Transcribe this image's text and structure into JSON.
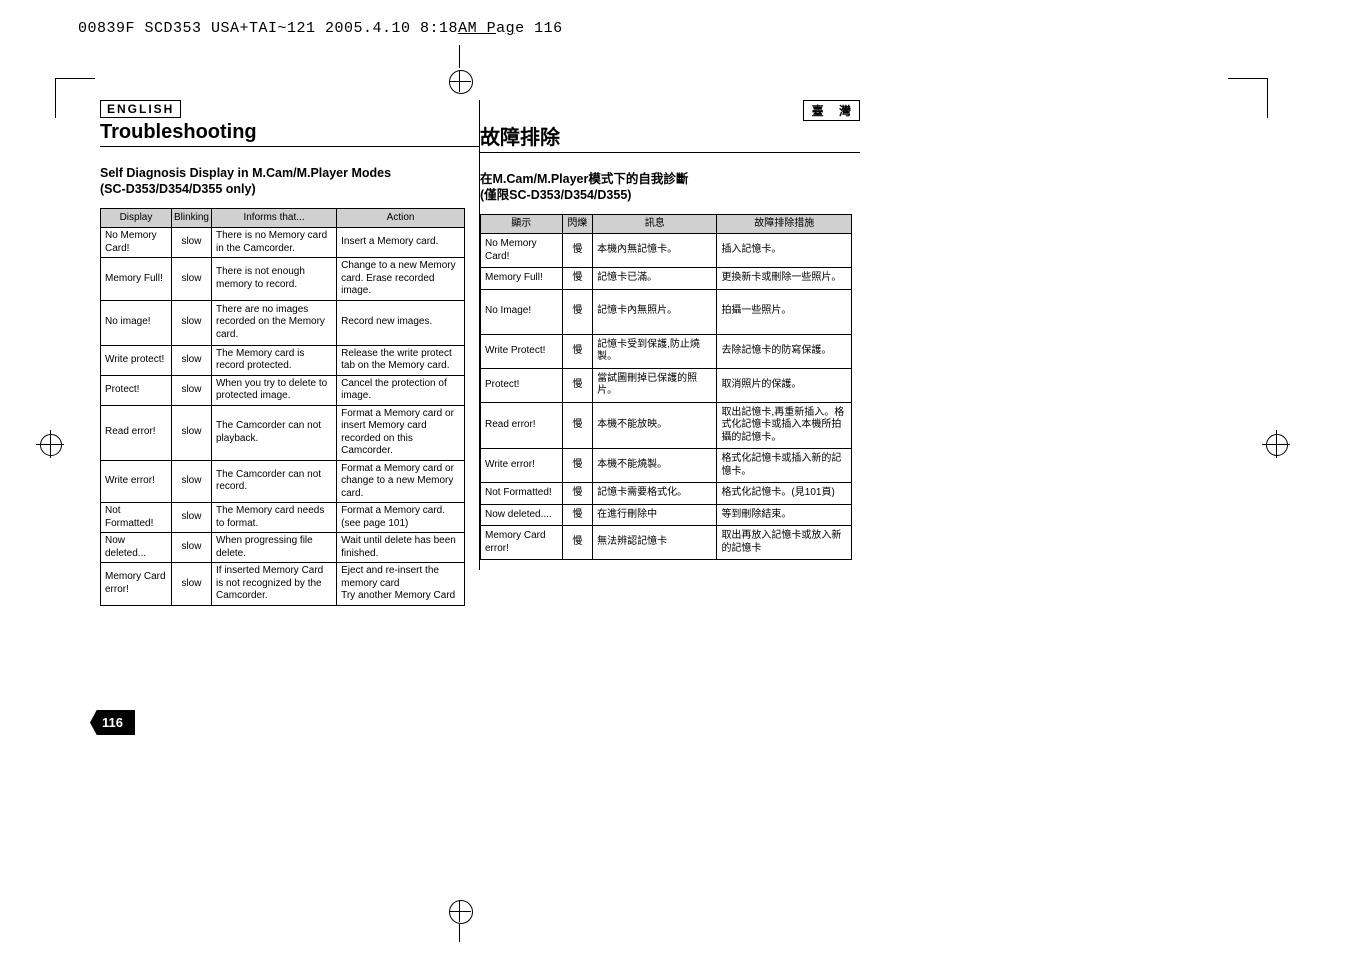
{
  "filename_line": {
    "prefix": "00839F SCD353 USA+TAI~121  2005.4.10  8:18",
    "u1": "AM  P",
    "mid": "a",
    "u2": "g",
    "suffix": "e 116"
  },
  "left": {
    "lang": "ENGLISH",
    "title": "Troubleshooting",
    "sub_line1": "Self Diagnosis Display in M.Cam/M.Player Modes",
    "sub_line2": "(SC-D353/D354/D355 only)",
    "headers": {
      "c1": "Display",
      "c2": "Blinking",
      "c3": "Informs that...",
      "c4": "Action"
    },
    "rows": [
      {
        "c1": "No Memory Card!",
        "c2": "slow",
        "c3": "There is no Memory card in the Camcorder.",
        "c4": "Insert a Memory card."
      },
      {
        "c1": "Memory Full!",
        "c2": "slow",
        "c3": "There is not enough memory to record.",
        "c4": "Change to a new Memory card. Erase recorded image."
      },
      {
        "c1": "No image!",
        "c2": "slow",
        "c3": "There are no images recorded on the Memory card.",
        "c4": "Record new images."
      },
      {
        "c1": "Write protect!",
        "c2": "slow",
        "c3": "The Memory card is record protected.",
        "c4": "Release the write protect tab on the Memory card."
      },
      {
        "c1": "Protect!",
        "c2": "slow",
        "c3": "When you try to delete to protected image.",
        "c4": "Cancel the protection of image."
      },
      {
        "c1": "Read error!",
        "c2": "slow",
        "c3": "The Camcorder can not playback.",
        "c4": "Format a Memory card or insert Memory card recorded on this Camcorder."
      },
      {
        "c1": "Write error!",
        "c2": "slow",
        "c3": "The Camcorder can not record.",
        "c4": "Format a Memory card or change to a new Memory card."
      },
      {
        "c1": "Not Formatted!",
        "c2": "slow",
        "c3": "The Memory card needs to format.",
        "c4": "Format a Memory card. (see page 101)"
      },
      {
        "c1": "Now deleted...",
        "c2": "slow",
        "c3": "When progressing file delete.",
        "c4": "Wait until delete has been finished."
      },
      {
        "c1": "Memory Card error!",
        "c2": "slow",
        "c3": "If inserted Memory Card is not recognized by the Camcorder.",
        "c4": "Eject and re-insert the memory card\nTry another Memory Card"
      }
    ]
  },
  "right": {
    "lang": "臺 灣",
    "title": "故障排除",
    "sub_line1": "在M.Cam/M.Player模式下的自我診斷",
    "sub_line2": "(僅限SC-D353/D354/D355)",
    "headers": {
      "c1": "顯示",
      "c2": "閃爍",
      "c3": "訊息",
      "c4": "故障排除措施"
    },
    "rows": [
      {
        "c1": "No Memory Card!",
        "c2": "慢",
        "c3": "本機內無記憶卡。",
        "c4": "插入記憶卡。"
      },
      {
        "c1": "Memory Full!",
        "c2": "慢",
        "c3": "記憶卡已滿。",
        "c4": "更換新卡或刪除一些照片。"
      },
      {
        "c1": "No Image!",
        "c2": "慢",
        "c3": "記憶卡內無照片。",
        "c4": "拍攝一些照片。"
      },
      {
        "c1": "Write Protect!",
        "c2": "慢",
        "c3": "記憶卡受到保護,防止燒製。",
        "c4": "去除記憶卡的防寫保護。"
      },
      {
        "c1": "Protect!",
        "c2": "慢",
        "c3": "當試圖刪掉已保護的照片。",
        "c4": "取消照片的保護。"
      },
      {
        "c1": "Read error!",
        "c2": "慢",
        "c3": "本機不能放映。",
        "c4": "取出記憶卡,再重新插入。格式化記憶卡或插入本機所拍攝的記憶卡。"
      },
      {
        "c1": "Write error!",
        "c2": "慢",
        "c3": "本機不能燒製。",
        "c4": "格式化記憶卡或插入新的記憶卡。"
      },
      {
        "c1": "Not Formatted!",
        "c2": "慢",
        "c3": "記憶卡需要格式化。",
        "c4": "格式化記憶卡。(見101頁)"
      },
      {
        "c1": "Now deleted....",
        "c2": "慢",
        "c3": "在進行刪除中",
        "c4": "等到刪除結束。"
      },
      {
        "c1": "Memory Card error!",
        "c2": "慢",
        "c3": "無法辨認記憶卡",
        "c4": "取出再放入記憶卡或放入新的記憶卡"
      }
    ]
  },
  "page_number": "116"
}
